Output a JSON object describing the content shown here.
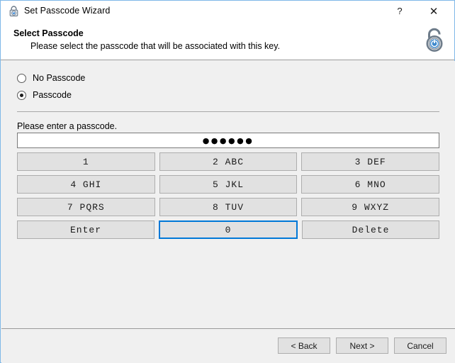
{
  "window": {
    "title": "Set Passcode Wizard",
    "icon": "padlock-icon",
    "border_color": "#7fb8e8",
    "background_color": "#f0f0f0",
    "titlebar_buttons": [
      {
        "name": "help-button",
        "label": "?"
      },
      {
        "name": "close-button",
        "label": "✕"
      }
    ]
  },
  "header": {
    "title": "Select Passcode",
    "subtitle": "Please select the passcode that will be associated with this key.",
    "icon": "open-padlock-power-icon",
    "icon_accent_color": "#2a7fd4"
  },
  "options": {
    "no_passcode": {
      "label": "No Passcode",
      "checked": false
    },
    "passcode": {
      "label": "Passcode",
      "checked": true
    }
  },
  "passcode": {
    "prompt": "Please enter a passcode.",
    "masked_value": "●●●●●●",
    "placeholder": "",
    "digit_count": "6"
  },
  "keypad": {
    "focused_key": "0",
    "rows": [
      [
        {
          "name": "key-1",
          "label": "1"
        },
        {
          "name": "key-2",
          "label": "2  ABC"
        },
        {
          "name": "key-3",
          "label": "3  DEF"
        }
      ],
      [
        {
          "name": "key-4",
          "label": "4  GHI"
        },
        {
          "name": "key-5",
          "label": "5  JKL"
        },
        {
          "name": "key-6",
          "label": "6  MNO"
        }
      ],
      [
        {
          "name": "key-7",
          "label": "7 PQRS"
        },
        {
          "name": "key-8",
          "label": "8  TUV"
        },
        {
          "name": "key-9",
          "label": "9 WXYZ"
        }
      ],
      [
        {
          "name": "key-enter",
          "label": "Enter"
        },
        {
          "name": "key-0",
          "label": "0"
        },
        {
          "name": "key-delete",
          "label": "Delete"
        }
      ]
    ]
  },
  "footer": {
    "buttons": [
      {
        "name": "back-button",
        "label": "< Back"
      },
      {
        "name": "next-button",
        "label": "Next >"
      },
      {
        "name": "cancel-button",
        "label": "Cancel"
      }
    ]
  }
}
